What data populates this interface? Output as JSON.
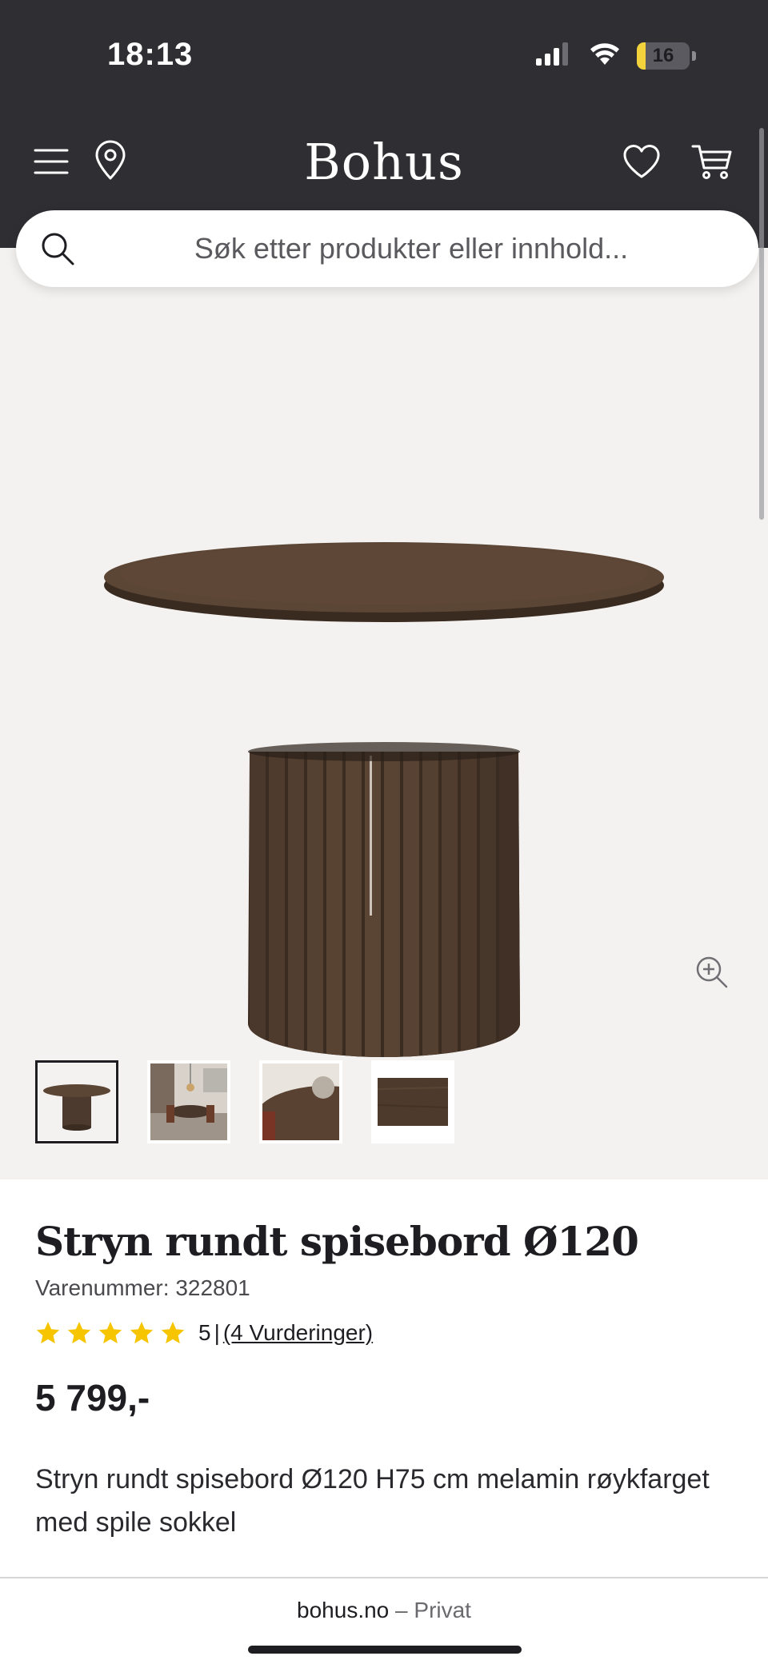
{
  "status_bar": {
    "time": "18:13",
    "battery_level": "16",
    "battery_fraction": 0.16,
    "battery_color": "#f2d33b",
    "icons": [
      "cellular-signal-icon",
      "wifi-icon",
      "battery-charging-icon"
    ]
  },
  "header": {
    "logo": "Bohus",
    "background": "#2f2f33",
    "icons": [
      "menu-icon",
      "location-pin-icon",
      "heart-icon",
      "cart-icon"
    ]
  },
  "search": {
    "placeholder": "Søk etter produkter eller innhold..."
  },
  "gallery": {
    "background": "#f4f2f0",
    "thumbnails": [
      {
        "name": "table-product",
        "active": true
      },
      {
        "name": "dining-room-scene",
        "active": false
      },
      {
        "name": "table-top-closeup",
        "active": false
      },
      {
        "name": "wood-finish-swatch",
        "active": false
      }
    ]
  },
  "product": {
    "title": "Stryn rundt spisebord Ø120",
    "sku": "Varenummer: 322801",
    "rating": {
      "stars": 5,
      "score": "5",
      "separator": "|",
      "reviews_link": "(4 Vurderinger)",
      "star_color": "#f6c500"
    },
    "price": "5 799,-",
    "description": "Stryn rundt spisebord Ø120 H75 cm melamin røykfarget med spile sokkel"
  },
  "bottom_bar": {
    "site": "bohus.no",
    "separator": " – ",
    "mode": "Privat"
  }
}
